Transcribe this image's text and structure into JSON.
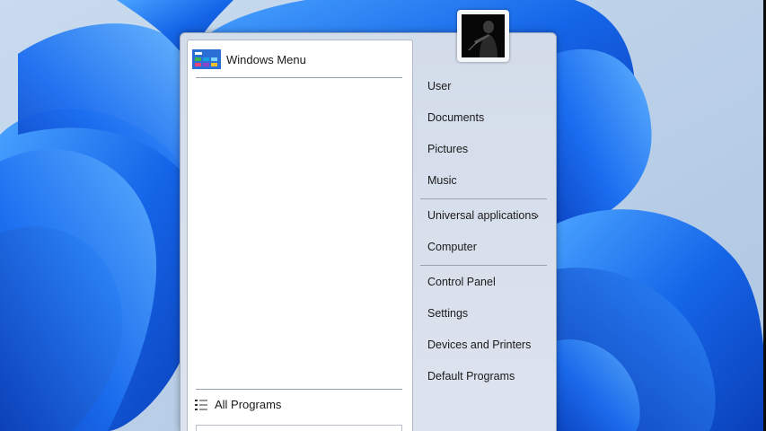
{
  "left_pane": {
    "pinned": [
      {
        "label": "Windows Menu",
        "icon": "windows-menu-tile-icon",
        "icon_color": "#2b6fd6"
      }
    ],
    "all_programs": {
      "label": "All Programs",
      "icon": "list-icon"
    }
  },
  "user": {
    "avatar_icon": "user-avatar"
  },
  "right_pane": {
    "items": [
      {
        "label": "User"
      },
      {
        "label": "Documents"
      },
      {
        "label": "Pictures"
      },
      {
        "label": "Music"
      },
      {
        "label": "Universal applications",
        "has_submenu": true,
        "chevron": "›"
      },
      {
        "label": "Computer"
      },
      {
        "label": "Control Panel"
      },
      {
        "label": "Settings"
      },
      {
        "label": "Devices and Printers"
      },
      {
        "label": "Default Programs"
      }
    ]
  },
  "colors": {
    "wallpaper_base": "#b7cde4",
    "bloom_blue": "#1f64e6",
    "menu_background": "#d3dcea"
  }
}
